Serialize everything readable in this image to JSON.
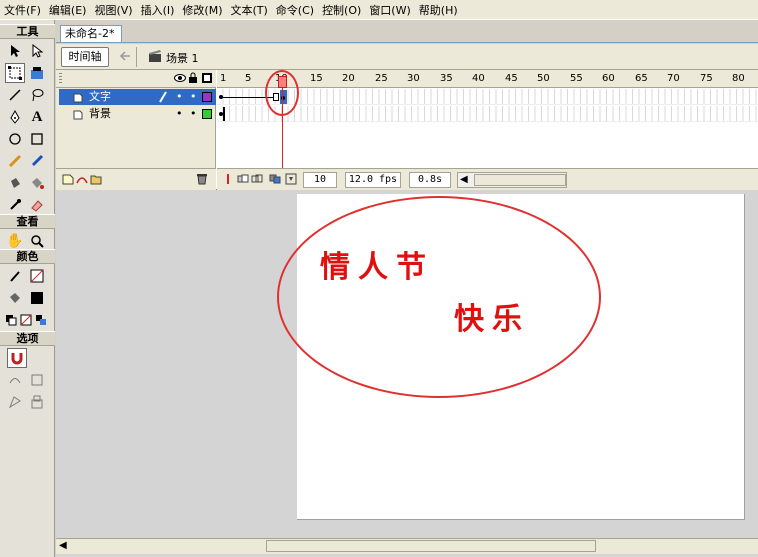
{
  "menu": [
    "文件(F)",
    "编辑(E)",
    "视图(V)",
    "插入(I)",
    "修改(M)",
    "文本(T)",
    "命令(C)",
    "控制(O)",
    "窗口(W)",
    "帮助(H)"
  ],
  "toolbox": {
    "tools_label": "工具",
    "view_label": "查看",
    "colors_label": "颜色",
    "options_label": "选项"
  },
  "doc": {
    "tab": "未命名-2*",
    "timeline_button": "时间轴",
    "scene": "场景 1"
  },
  "layers": [
    {
      "name": "文字",
      "color": "#9933cc",
      "selected": true
    },
    {
      "name": "背景",
      "color": "#33cc33",
      "selected": false
    }
  ],
  "ruler": [
    "1",
    "5",
    "10",
    "15",
    "20",
    "25",
    "30",
    "35",
    "40",
    "45",
    "50",
    "55",
    "60",
    "65",
    "70",
    "75",
    "80"
  ],
  "status": {
    "frame": "10",
    "fps": "12.0 fps",
    "time": "0.8s"
  },
  "stage": {
    "line1": "情人节",
    "line2": "快乐"
  },
  "accent": "#e03030"
}
